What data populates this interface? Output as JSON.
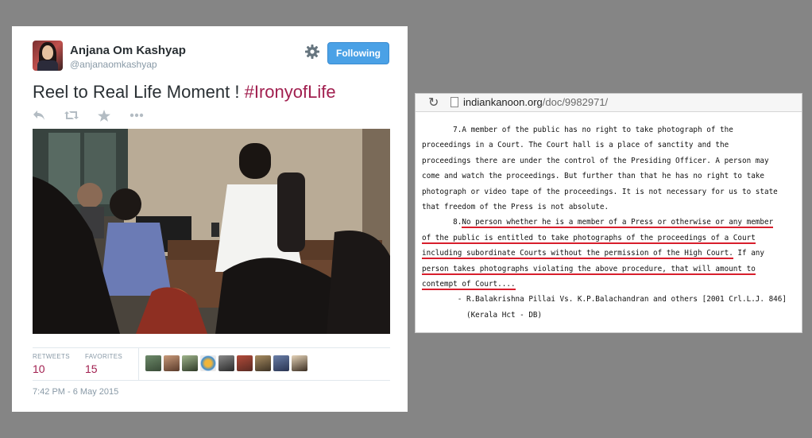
{
  "tweet": {
    "user_name": "Anjana Om Kashyap",
    "handle": "@anjanaomkashyap",
    "follow_label": "Following",
    "text_main": "Reel to Real Life Moment !",
    "text_hashtag": "#IronyofLife",
    "actions": [
      "reply-icon",
      "retweet-icon",
      "favorite-icon",
      "more-icon"
    ],
    "retweets_label": "RETWEETS",
    "retweets_count": "10",
    "favorites_label": "FAVORITES",
    "favorites_count": "15",
    "timestamp": "7:42 PM - 6 May 2015",
    "colors": {
      "accent": "#a11f4f",
      "button": "#4aa1e6"
    }
  },
  "browser": {
    "url_host": "indiankanoon.org",
    "url_path": "/doc/9982971/",
    "lines": [
      "       7.A member of the public has no right to take photograph of the",
      "proceedings in a Court. The Court hall is a place of sanctity and the",
      "proceedings there are under the control of the Presiding Officer. A person may",
      "come and watch the proceedings. But further than that he has no right to take",
      "photograph or video tape of the proceedings. It is not necessary for us to state",
      "that freedom of the Press is not absolute."
    ],
    "para8_prefix": "       8.",
    "para8_lines": [
      "No person whether he is a member of a Press or otherwise or any member",
      "of the public is entitled to take photographs of the proceedings of a Court",
      "including subordinate Courts without the permission of the High Court.",
      "person takes photographs violating the above procedure, that will amount to",
      "contempt of Court...."
    ],
    "para8_line3_tail": " If any",
    "citation_1": "        - R.Balakrishna Pillai Vs. K.P.Balachandran and others [2001 Crl.L.J. 846]",
    "citation_2": "          (Kerala Hct - DB)",
    "highlight_color": "#d81e2c"
  }
}
